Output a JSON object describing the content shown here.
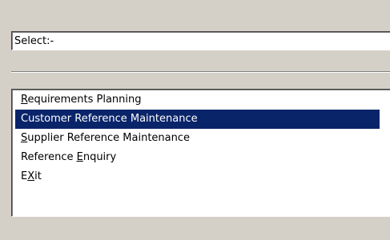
{
  "select_field": {
    "value": "Select:-"
  },
  "menu": {
    "items": [
      {
        "pre": "",
        "key": "R",
        "post": "equirements Planning",
        "selected": false
      },
      {
        "pre": "Customer Reference Maintenance",
        "key": "",
        "post": "",
        "selected": true
      },
      {
        "pre": "",
        "key": "S",
        "post": "upplier Reference Maintenance",
        "selected": false
      },
      {
        "pre": "Reference ",
        "key": "E",
        "post": "nquiry",
        "selected": false
      },
      {
        "pre": "E",
        "key": "X",
        "post": "it",
        "selected": false
      }
    ]
  },
  "colors": {
    "window_bg": "#d4d0c8",
    "selection_bg": "#0a246a",
    "selection_fg": "#ffffff"
  }
}
